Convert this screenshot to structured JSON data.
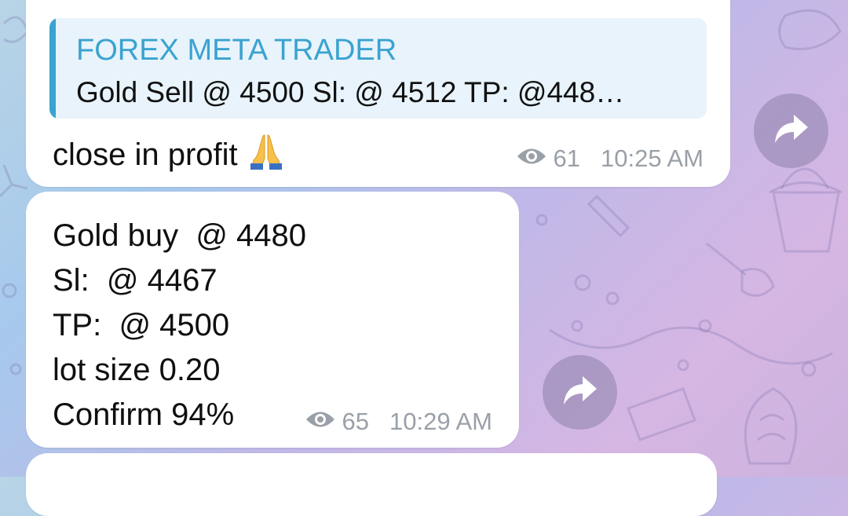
{
  "messages": [
    {
      "reply": {
        "author": "FOREX META TRADER",
        "text": "Gold Sell @ 4500 Sl:  @ 4512 TP:  @448…"
      },
      "text": "close in profit",
      "emoji": "folded-hands-icon",
      "views": "61",
      "time": "10:25 AM"
    },
    {
      "lines": [
        "Gold buy  @ 4480",
        "Sl:  @ 4467",
        "TP:  @ 4500",
        "lot size 0.20",
        "Confirm 94%"
      ],
      "views": "65",
      "time": "10:29 AM"
    }
  ],
  "icons": {
    "views": "eye-icon",
    "forward": "share-arrow-icon"
  },
  "colors": {
    "accent": "#3aa3d0",
    "reply_background": "#e8f3fb",
    "meta_text": "#9aa0a8",
    "forward_button": "#8c82aa"
  }
}
